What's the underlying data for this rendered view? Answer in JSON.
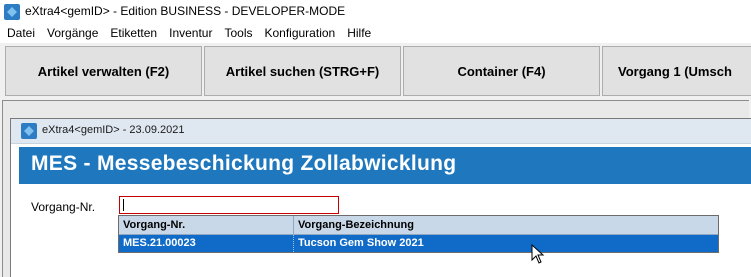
{
  "window": {
    "title": "eXtra4<gemID> - Edition BUSINESS - DEVELOPER-MODE"
  },
  "menu": [
    "Datei",
    "Vorgänge",
    "Etiketten",
    "Inventur",
    "Tools",
    "Konfiguration",
    "Hilfe"
  ],
  "toolbar": [
    {
      "label": "Artikel verwalten (F2)"
    },
    {
      "label": "Artikel suchen (STRG+F)"
    },
    {
      "label": "Container (F4)"
    },
    {
      "label": "Vorgang 1 (Umsch"
    }
  ],
  "inner_window": {
    "title": "eXtra4<gemID>  -  23.09.2021",
    "banner": "MES - Messebeschickung Zollabwicklung"
  },
  "form": {
    "vorgang_label": "Vorgang-Nr.",
    "vorgang_value": ""
  },
  "dropdown": {
    "columns": [
      "Vorgang-Nr.",
      "Vorgang-Bezeichnung"
    ],
    "rows": [
      {
        "nr": "MES.21.00023",
        "bezeichnung": "Tucson Gem Show 2021",
        "selected": true
      }
    ]
  },
  "colors": {
    "banner": "#1f78bd",
    "selected_row": "#0f6bc7",
    "input_border": "#c40000"
  }
}
